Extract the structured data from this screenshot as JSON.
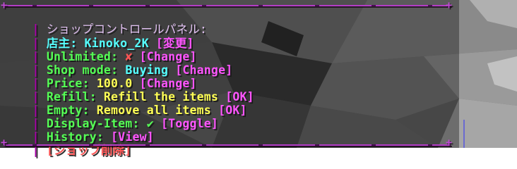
{
  "chat": {
    "title": "ショップコントロールパネル:",
    "owner": {
      "label": "店主: ",
      "value": "Kinoko_2K",
      "action": "[変更]"
    },
    "unlimited": {
      "label": "Unlimited: ",
      "value": "✘",
      "action": "[Change]"
    },
    "shop_mode": {
      "label": "Shop mode: ",
      "value": "Buying",
      "action": "[Change]"
    },
    "price": {
      "label": "Price: ",
      "value": "100.0",
      "action": "[Change]"
    },
    "refill": {
      "label": "Refill: ",
      "value": "Refill the items",
      "action": "[OK]"
    },
    "empty": {
      "label": "Empty: ",
      "value": "Remove all items",
      "action": "[OK]"
    },
    "display_item": {
      "label": "Display-Item: ",
      "value": "✔",
      "action": "[Toggle]"
    },
    "history": {
      "label": "History: ",
      "action": "[View]"
    },
    "delete": {
      "action": "[ショップ削除]"
    },
    "bar_char": "| ",
    "plus_char": "+"
  },
  "colors": {
    "separator": "#b33dc6",
    "label_aqua": "#55ffff",
    "label_green": "#55ff55",
    "value_yellow": "#ffff55",
    "value_red": "#ff5555",
    "action_pink": "#ff55ff"
  }
}
